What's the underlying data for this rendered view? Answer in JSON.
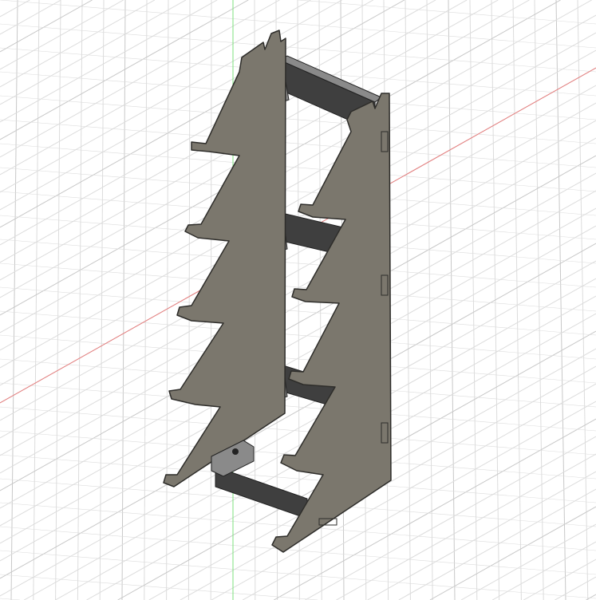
{
  "viewport": {
    "background_color": "#ffffff",
    "grid_color": "#dcdcdc",
    "grid_major_color": "#c8c8c8",
    "x_axis_color": "#e88080",
    "y_axis_color": "#7ee07e"
  },
  "model": {
    "panel_color": "#7b776d",
    "panel_edge_color": "#2e2d2a",
    "crossbar_dark_color": "#3f3f3f",
    "crossbar_light_color": "#8a8a8a",
    "crossbar_count": 4
  }
}
